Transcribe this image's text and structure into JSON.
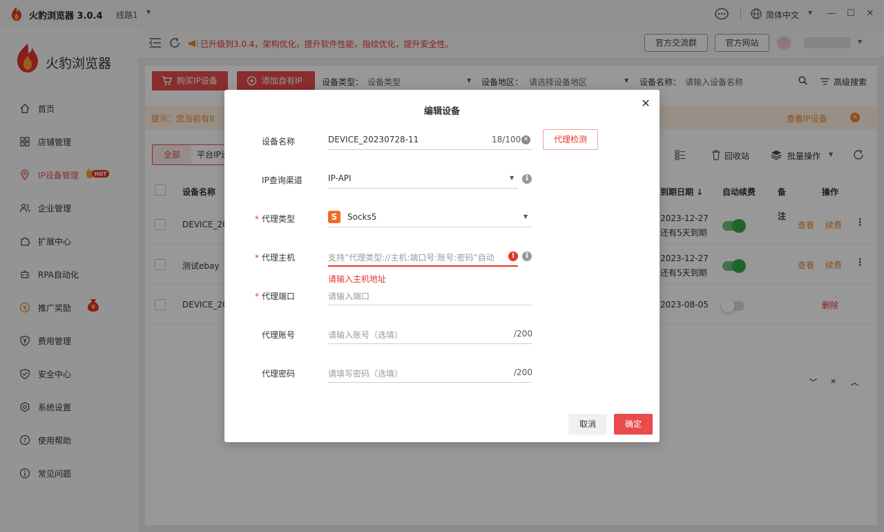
{
  "app": {
    "title": "火豹浏览器 3.0.4",
    "line": "线路1",
    "brand": "火豹浏览器",
    "language": "简体中文"
  },
  "sidebar": {
    "items": [
      {
        "label": "首页",
        "icon": "home-icon"
      },
      {
        "label": "店铺管理",
        "icon": "grid-icon"
      },
      {
        "label": "IP设备管理",
        "icon": "location-icon",
        "active": true,
        "badge": "HOT"
      },
      {
        "label": "企业管理",
        "icon": "users-icon"
      },
      {
        "label": "扩展中心",
        "icon": "extension-icon"
      },
      {
        "label": "RPA自动化",
        "icon": "robot-icon"
      },
      {
        "label": "推广奖励",
        "icon": "reward-icon",
        "badge_icon": "money-bag-icon"
      },
      {
        "label": "费用管理",
        "icon": "yen-shield-icon"
      },
      {
        "label": "安全中心",
        "icon": "shield-icon"
      },
      {
        "label": "系统设置",
        "icon": "settings-icon"
      },
      {
        "label": "使用帮助",
        "icon": "help-icon"
      },
      {
        "label": "常见问题",
        "icon": "info-icon"
      }
    ]
  },
  "topbar": {
    "notice": "已升级到3.0.4，架构优化，提升软件性能，指纹优化，提升安全性。",
    "group_btn": "官方交流群",
    "site_btn": "官方网站"
  },
  "toolbar": {
    "buy_btn": "购买IP设备",
    "add_btn": "添加自有IP",
    "device_type_label": "设备类型：",
    "device_type_value": "设备类型",
    "region_label": "设备地区：",
    "region_placeholder": "请选择设备地区",
    "name_label": "设备名称：",
    "name_placeholder": "请输入设备名称",
    "advanced": "高级搜索"
  },
  "tip": {
    "text": "提示：您当前有II",
    "link": "查看IP设备",
    "close": "×"
  },
  "tabs": {
    "all": "全部",
    "platform": "平台IP设"
  },
  "table_tools": {
    "recycle": "回收站",
    "batch": "批量操作"
  },
  "table": {
    "headers": {
      "name": "设备名称",
      "expire": "到期日期 ↓",
      "auto_renew": "自动续费",
      "note": "备",
      "action": "操作"
    },
    "rows": [
      {
        "name": "DEVICE_20",
        "expire": "2023-12-27",
        "expire_note": "还有5天到期",
        "auto_renew": true,
        "note": "注",
        "view": "查看",
        "renew": "续费"
      },
      {
        "name": "测试ebay",
        "expire": "2023-12-27",
        "expire_note": "还有5天到期",
        "auto_renew": true,
        "view": "查看",
        "renew": "续费"
      },
      {
        "name": "DEVICE_20",
        "expire": "2023-08-05",
        "auto_renew": false,
        "delete": "删除"
      }
    ]
  },
  "dialog": {
    "title": "编辑设备",
    "fields": {
      "device_name": {
        "label": "设备名称",
        "value": "DEVICE_20230728-11",
        "counter": "18/100"
      },
      "ip_channel": {
        "label": "IP查询渠道",
        "value": "IP-API"
      },
      "proxy_type": {
        "label": "代理类型",
        "value": "Socks5",
        "icon_letter": "S"
      },
      "proxy_host": {
        "label": "代理主机",
        "placeholder": "支持“代理类型://主机:端口号:账号:密码”自动",
        "error": "请输入主机地址"
      },
      "proxy_port": {
        "label": "代理端口",
        "placeholder": "请输入端口"
      },
      "proxy_account": {
        "label": "代理账号",
        "placeholder": "请输入账号（选填）",
        "counter": "/200"
      },
      "proxy_password": {
        "label": "代理密码",
        "placeholder": "请填写密码（选填）",
        "counter": "/200"
      }
    },
    "required_mark": "*",
    "proxy_check_btn": "代理检测",
    "cancel_btn": "取消",
    "ok_btn": "确定"
  },
  "colors": {
    "accent": "#e54b4b",
    "warning": "#e8862f",
    "success": "#3aa64b"
  }
}
